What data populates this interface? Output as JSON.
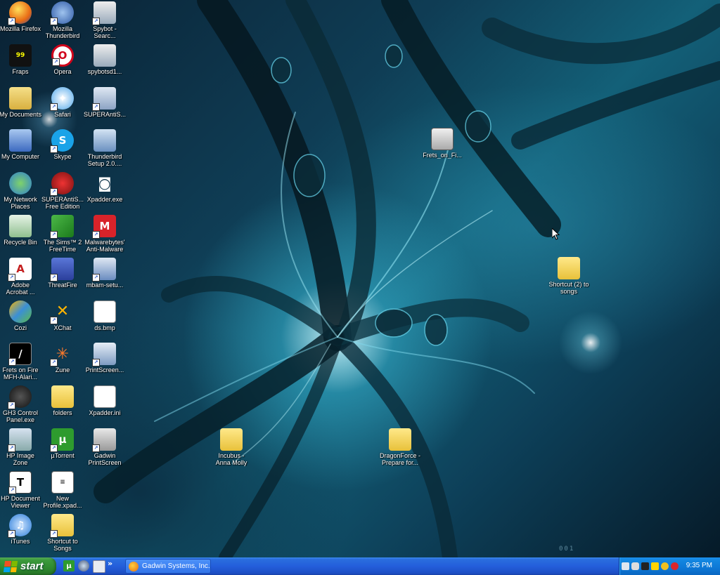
{
  "desktop": {
    "icons": [
      {
        "label_lines": [
          "Mozilla Firefox"
        ],
        "name": "firefox"
      },
      {
        "label_lines": [
          "Fraps"
        ],
        "name": "fraps"
      },
      {
        "label_lines": [
          "My Documents"
        ],
        "name": "my-documents"
      },
      {
        "label_lines": [
          "My Computer"
        ],
        "name": "my-computer"
      },
      {
        "label_lines": [
          "My Network",
          "Places"
        ],
        "name": "my-network-places"
      },
      {
        "label_lines": [
          "Recycle Bin"
        ],
        "name": "recycle-bin"
      },
      {
        "label_lines": [
          "Adobe",
          "Acrobat ..."
        ],
        "name": "adobe-acrobat"
      },
      {
        "label_lines": [
          "Cozi"
        ],
        "name": "cozi"
      },
      {
        "label_lines": [
          "Frets on Fire",
          "MFH-Alari..."
        ],
        "name": "frets-on-fire"
      },
      {
        "label_lines": [
          "GH3 Control",
          "Panel.exe"
        ],
        "name": "gh3-control-panel"
      },
      {
        "label_lines": [
          "HP Image",
          "Zone"
        ],
        "name": "hp-image-zone"
      },
      {
        "label_lines": [
          "HP Document",
          "Viewer"
        ],
        "name": "hp-document-viewer"
      },
      {
        "label_lines": [
          "iTunes"
        ],
        "name": "itunes"
      },
      {
        "label_lines": [
          "Mozilla",
          "Thunderbird"
        ],
        "name": "thunderbird"
      },
      {
        "label_lines": [
          "Opera"
        ],
        "name": "opera"
      },
      {
        "label_lines": [
          "Safari"
        ],
        "name": "safari"
      },
      {
        "label_lines": [
          "Skype"
        ],
        "name": "skype"
      },
      {
        "label_lines": [
          "SUPERAntiS...",
          "Free Edition"
        ],
        "name": "superantispyware-free"
      },
      {
        "label_lines": [
          "The Sims™ 2",
          "FreeTime"
        ],
        "name": "sims2"
      },
      {
        "label_lines": [
          "ThreatFire"
        ],
        "name": "threatfire"
      },
      {
        "label_lines": [
          "XChat"
        ],
        "name": "xchat"
      },
      {
        "label_lines": [
          "Zune"
        ],
        "name": "zune"
      },
      {
        "label_lines": [
          "folders"
        ],
        "name": "folders"
      },
      {
        "label_lines": [
          "µTorrent"
        ],
        "name": "utorrent"
      },
      {
        "label_lines": [
          "New",
          "Profile.xpad..."
        ],
        "name": "new-profile-xpad"
      },
      {
        "label_lines": [
          "Shortcut to",
          "Songs"
        ],
        "name": "shortcut-to-songs"
      },
      {
        "label_lines": [
          "Spybot -",
          "Searc..."
        ],
        "name": "spybot"
      },
      {
        "label_lines": [
          "spybotsd1..."
        ],
        "name": "spybotsd"
      },
      {
        "label_lines": [
          "SUPERAntiS..."
        ],
        "name": "superantispyware"
      },
      {
        "label_lines": [
          "Thunderbird",
          "Setup 2.0...."
        ],
        "name": "thunderbird-setup"
      },
      {
        "label_lines": [
          "Xpadder.exe"
        ],
        "name": "xpadder-exe"
      },
      {
        "label_lines": [
          "Malwarebytes'",
          "Anti-Malware"
        ],
        "name": "malwarebytes"
      },
      {
        "label_lines": [
          "mbam-setu..."
        ],
        "name": "mbam-setup"
      },
      {
        "label_lines": [
          "ds.bmp"
        ],
        "name": "ds-bmp"
      },
      {
        "label_lines": [
          "PrintScreen..."
        ],
        "name": "printscreen"
      },
      {
        "label_lines": [
          "Xpadder.ini"
        ],
        "name": "xpadder-ini"
      },
      {
        "label_lines": [
          "Gadwin",
          "PrintScreen"
        ],
        "name": "gadwin-printscreen"
      },
      {
        "label_lines": [
          "Frets_on_Fi..."
        ],
        "name": "frets-on-fire-folder"
      },
      {
        "label_lines": [
          "Shortcut (2) to",
          "songs"
        ],
        "name": "shortcut-2-to-songs"
      },
      {
        "label_lines": [
          "Incubus -",
          "Anna Molly"
        ],
        "name": "incubus-anna-molly"
      },
      {
        "label_lines": [
          "DragonForce -",
          "Prepare for..."
        ],
        "name": "dragonforce"
      }
    ],
    "watermark": "001"
  },
  "taskbar": {
    "start_label": "start",
    "quick_launch_more": "»",
    "task_button_label": "Gadwin Systems, Inc....",
    "clock": "9:35 PM"
  },
  "colors": {
    "taskbar_blue": "#245edb",
    "start_green": "#3c9a3c",
    "tray_blue": "#0d78d6"
  }
}
